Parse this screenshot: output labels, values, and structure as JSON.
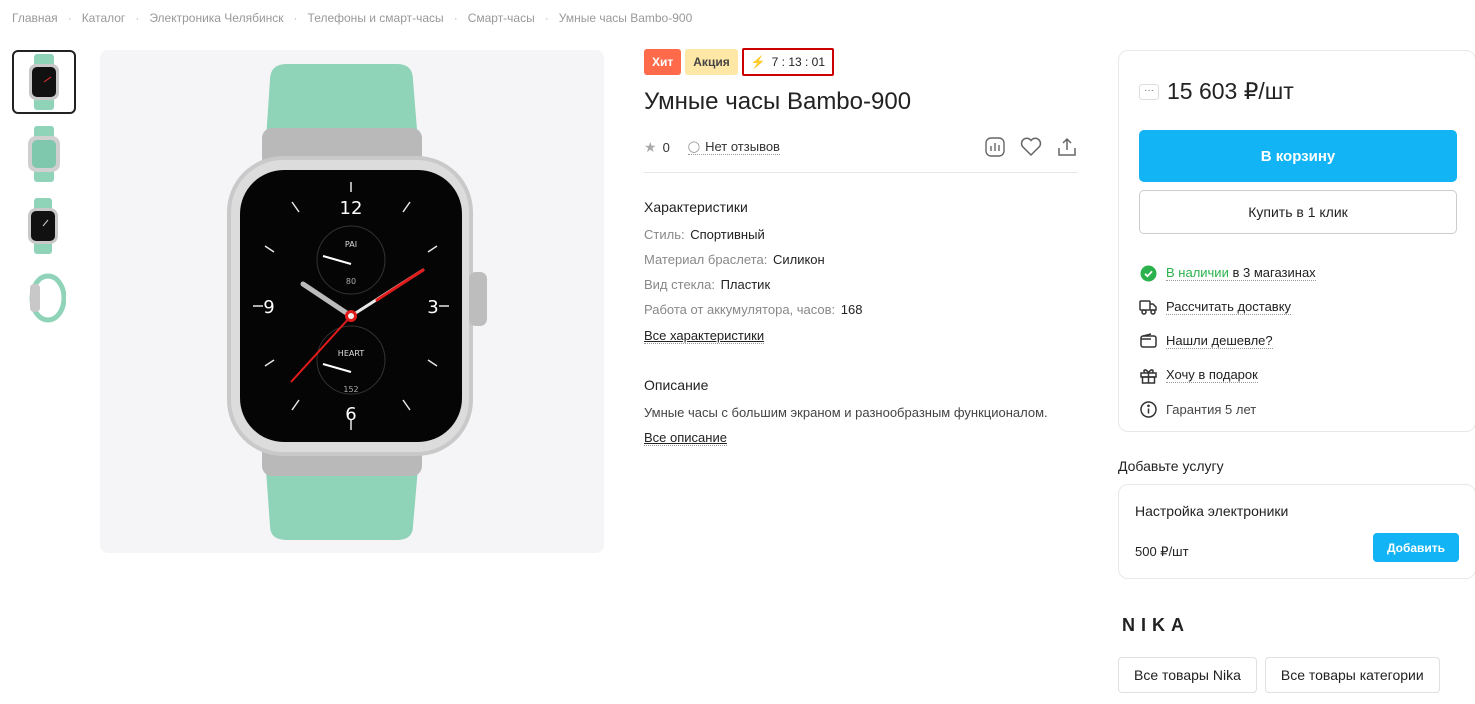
{
  "breadcrumb": [
    "Главная",
    "Каталог",
    "Электроника Челябинск",
    "Телефоны и смарт-часы",
    "Смарт-часы",
    "Умные часы Bambo-900"
  ],
  "breadcrumb_sep": "·",
  "badges": {
    "hit": "Хит",
    "promo": "Акция",
    "timer": "7 : 13 : 01"
  },
  "product": {
    "title": "Умные часы Bambo-900",
    "rating": "0",
    "reviews": "Нет отзывов"
  },
  "specs": {
    "heading": "Характеристики",
    "items": [
      {
        "k": "Стиль:",
        "v": "Спортивный"
      },
      {
        "k": "Материал браслета:",
        "v": "Силикон"
      },
      {
        "k": "Вид стекла:",
        "v": "Пластик"
      },
      {
        "k": "Работа от аккумулятора, часов:",
        "v": "168"
      }
    ],
    "all_link": "Все характеристики"
  },
  "description": {
    "heading": "Описание",
    "text": "Умные часы с большим экраном и разнообразным функционалом.",
    "all_link": "Все описание"
  },
  "watch_face": {
    "top": "12",
    "bottom": "6",
    "left": "9",
    "right": "3",
    "pai": "PAI",
    "pai_val": "80",
    "heart": "HEART",
    "heart_val": "152"
  },
  "buy": {
    "price_more": "···",
    "price": "15 603 ₽/шт",
    "cart_btn": "В корзину",
    "one_click_btn": "Купить в 1 клик",
    "stock_green": "В наличии",
    "stock_rest": "в 3 магазинах",
    "delivery": "Рассчитать доставку",
    "cheaper": "Нашли дешевле?",
    "gift": "Хочу в подарок",
    "warranty": "Гарантия 5 лет"
  },
  "service": {
    "heading": "Добавьте услугу",
    "name": "Настройка электроники",
    "price": "500 ₽/шт",
    "add_btn": "Добавить"
  },
  "brand": {
    "logo": "NIKA",
    "all_brand": "Все товары Nika",
    "all_category": "Все товары категории"
  },
  "colors": {
    "accent": "#12b4f5",
    "hit": "#ff6b4a",
    "promo": "#ffe8a6",
    "green": "#2bb24c",
    "strap": "#8fd3b8"
  }
}
